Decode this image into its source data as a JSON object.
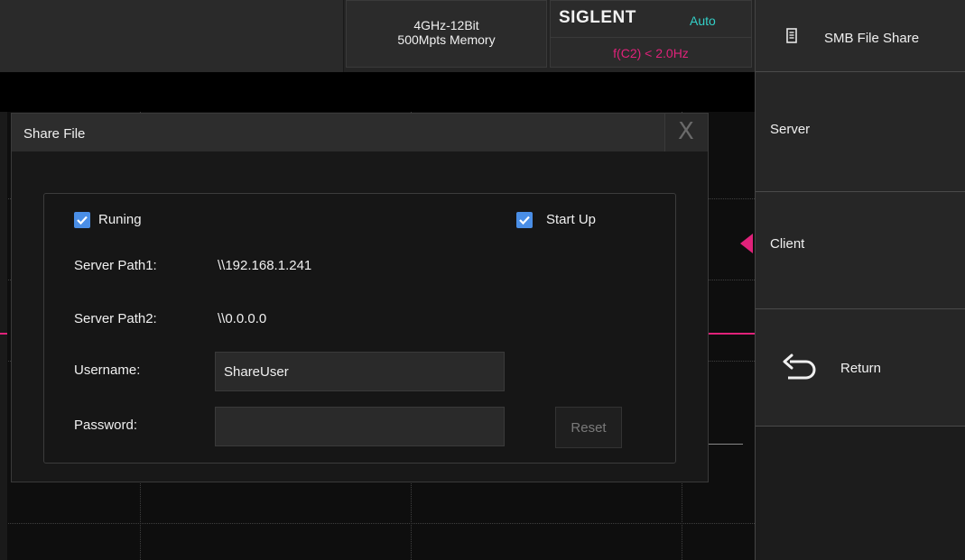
{
  "header": {
    "spec_line1": "4GHz-12Bit",
    "spec_line2": "500Mpts Memory",
    "brand": "SIGLENT",
    "trigger_mode": "Auto",
    "trigger_condition": "f(C2) < 2.0Hz"
  },
  "menu": {
    "title": "SMB File Share",
    "items": [
      {
        "label": "Server"
      },
      {
        "label": "Client"
      },
      {
        "label": "Return"
      }
    ]
  },
  "dialog": {
    "title": "Share File",
    "close_glyph": "X",
    "running_label": "Runing",
    "running_checked": true,
    "startup_label": "Start Up",
    "startup_checked": true,
    "server_path1_label": "Server Path1:",
    "server_path1_value": "\\\\192.168.1.241",
    "server_path2_label": "Server Path2:",
    "server_path2_value": "\\\\0.0.0.0",
    "username_label": "Username:",
    "username_value": "ShareUser",
    "password_label": "Password:",
    "password_value": "",
    "reset_label": "Reset"
  },
  "colors": {
    "trigger_mode": "#33d0c8",
    "trigger_condition": "#e0227a",
    "checkbox": "#4a8ee6",
    "channel_marker": "#e0227a"
  },
  "icons": {
    "menu_title": "document-icon",
    "return": "return-arrow-icon",
    "checkbox": "checkmark-icon"
  }
}
